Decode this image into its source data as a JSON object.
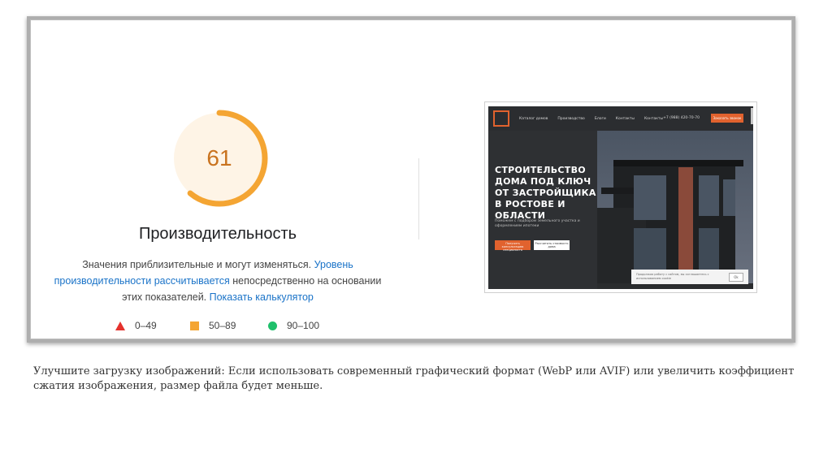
{
  "report": {
    "score": "61",
    "category_title": "Производительность",
    "description": {
      "part1": "Значения приблизительные и могут изменяться. ",
      "link1": "Уровень производительности рассчитывается",
      "part2": " непосредственно на основании этих показателей. ",
      "link2": "Показать калькулятор"
    },
    "score_fraction": 0.61,
    "legend": [
      {
        "range": "0–49",
        "shape": "triangle",
        "color": "#e5322d"
      },
      {
        "range": "50–89",
        "shape": "square",
        "color": "#f4a533"
      },
      {
        "range": "90–100",
        "shape": "circle",
        "color": "#1fc06b"
      }
    ],
    "colors": {
      "gauge": "#f4a533",
      "gauge_bg": "#fef4e6",
      "score_text": "#c9731f",
      "link": "#1a73c8"
    }
  },
  "screenshot": {
    "nav_links": [
      "Каталог домов",
      "Производство",
      "Блоги",
      "Контакты",
      "Контакты"
    ],
    "phone": "+7 (988) 420-70-70",
    "cta_button": "Заказать звонок",
    "hero_title": [
      "СТРОИТЕЛЬСТВО",
      "ДОМА ПОД КЛЮЧ",
      "ОТ ЗАСТРОЙЩИКА",
      "В РОСТОВЕ И",
      "ОБЛАСТИ"
    ],
    "hero_subtitle": "Поможем с подбором земельного участка и оформлением ипотеки",
    "button_primary": "Получить консультацию специалиста",
    "button_secondary": "Рассчитать стоимость дома",
    "cookie_text": "Продолжая работу с сайтом, вы соглашаетесь с использованием cookie",
    "cookie_ok": "Ok",
    "accent_color": "#e1622e"
  },
  "caption": "Улучшите загрузку изображений: Если использовать современный графический формат (WebP или AVIF) или увеличить коэффициент сжатия изображения, размер файла будет меньше."
}
